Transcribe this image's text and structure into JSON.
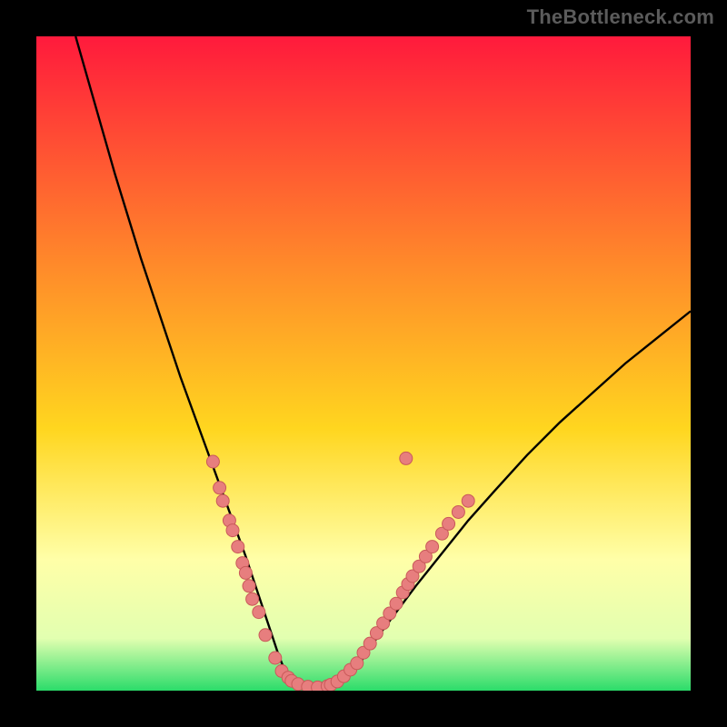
{
  "watermark": "TheBottleneck.com",
  "colors": {
    "background": "#000000",
    "gradient_top": "#ff1a3c",
    "gradient_mid_upper": "#ff8a2a",
    "gradient_mid": "#ffd61f",
    "gradient_pale": "#ffffa8",
    "gradient_lower": "#e2ffb0",
    "gradient_bottom": "#2bdc6a",
    "curve": "#000000",
    "points_fill": "#e77e7e",
    "points_stroke": "#c95a5a"
  },
  "chart_data": {
    "type": "line",
    "title": "",
    "xlabel": "",
    "ylabel": "",
    "xlim": [
      0,
      100
    ],
    "ylim": [
      0,
      100
    ],
    "series": [
      {
        "name": "bottleneck-curve",
        "x": [
          6,
          8,
          10,
          12,
          14,
          16,
          18,
          20,
          22,
          24,
          26,
          28,
          30,
          32,
          33,
          34,
          35,
          36,
          37,
          38,
          40,
          42,
          44,
          46,
          48,
          50,
          52,
          55,
          58,
          62,
          66,
          70,
          75,
          80,
          85,
          90,
          95,
          100
        ],
        "y": [
          100,
          93,
          86,
          79,
          72.5,
          66,
          60,
          54,
          48,
          42.5,
          37,
          31.5,
          26,
          20.5,
          17.5,
          14.5,
          11.5,
          8.5,
          5.5,
          3,
          1,
          0.5,
          0.5,
          1,
          2.5,
          5,
          8,
          12,
          16,
          21,
          26,
          30.5,
          36,
          41,
          45.5,
          50,
          54,
          58
        ]
      }
    ],
    "points": [
      {
        "x": 27.0,
        "y": 35.0
      },
      {
        "x": 28.0,
        "y": 31.0
      },
      {
        "x": 28.5,
        "y": 29.0
      },
      {
        "x": 29.5,
        "y": 26.0
      },
      {
        "x": 30.0,
        "y": 24.5
      },
      {
        "x": 30.8,
        "y": 22.0
      },
      {
        "x": 31.5,
        "y": 19.5
      },
      {
        "x": 32.0,
        "y": 18.0
      },
      {
        "x": 32.5,
        "y": 16.0
      },
      {
        "x": 33.0,
        "y": 14.0
      },
      {
        "x": 34.0,
        "y": 12.0
      },
      {
        "x": 35.0,
        "y": 8.5
      },
      {
        "x": 36.5,
        "y": 5.0
      },
      {
        "x": 37.5,
        "y": 3.0
      },
      {
        "x": 38.5,
        "y": 2.0
      },
      {
        "x": 39.0,
        "y": 1.5
      },
      {
        "x": 40.0,
        "y": 1.0
      },
      {
        "x": 41.5,
        "y": 0.6
      },
      {
        "x": 43.0,
        "y": 0.5
      },
      {
        "x": 44.5,
        "y": 0.7
      },
      {
        "x": 45.0,
        "y": 0.9
      },
      {
        "x": 46.0,
        "y": 1.4
      },
      {
        "x": 47.0,
        "y": 2.2
      },
      {
        "x": 48.0,
        "y": 3.2
      },
      {
        "x": 49.0,
        "y": 4.2
      },
      {
        "x": 50.0,
        "y": 5.8
      },
      {
        "x": 51.0,
        "y": 7.2
      },
      {
        "x": 52.0,
        "y": 8.8
      },
      {
        "x": 53.0,
        "y": 10.3
      },
      {
        "x": 54.0,
        "y": 11.8
      },
      {
        "x": 55.0,
        "y": 13.3
      },
      {
        "x": 56.0,
        "y": 15.0
      },
      {
        "x": 56.8,
        "y": 16.3
      },
      {
        "x": 57.5,
        "y": 17.5
      },
      {
        "x": 58.5,
        "y": 19.0
      },
      {
        "x": 59.5,
        "y": 20.5
      },
      {
        "x": 60.5,
        "y": 22.0
      },
      {
        "x": 62.0,
        "y": 24.0
      },
      {
        "x": 63.0,
        "y": 25.5
      },
      {
        "x": 64.5,
        "y": 27.3
      },
      {
        "x": 66.0,
        "y": 29.0
      },
      {
        "x": 56.5,
        "y": 35.5
      }
    ]
  }
}
